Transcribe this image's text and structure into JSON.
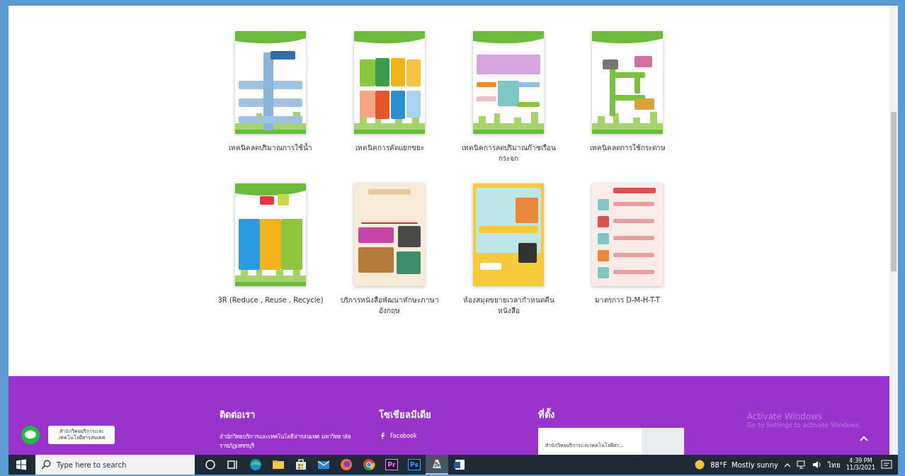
{
  "posters": [
    {
      "kind": "water",
      "caption": "เทคนิคลดปริมาณการใช้น้ำ"
    },
    {
      "kind": "waste",
      "caption": "เทคนิคการคัดแยกขยะ"
    },
    {
      "kind": "greenhouse",
      "caption": "เทคนิคการลดปริมาณก๊าซเรือนกระจก"
    },
    {
      "kind": "paper",
      "caption": "เทคนิคลดการใช้กระดาษ"
    },
    {
      "kind": "recycle",
      "caption": "3R (Reduce , Reuse , Recycle)"
    },
    {
      "kind": "english",
      "caption": "บริการหนังสือพัฒนาทักษะภาษาอังกฤษ"
    },
    {
      "kind": "library",
      "caption": "ห้องสมุดขยายเวลากำหนดคืนหนังสือ"
    },
    {
      "kind": "health",
      "caption": "มาตรการ D-M-H-T-T"
    }
  ],
  "footer": {
    "contact": {
      "heading": "ติดต่อเรา",
      "text": "สำนักวิทยบริการและเทคโนโลยีสารสนเทศ มหาวิทยาลัยราชภัฏเพชรบุรี"
    },
    "social": {
      "heading": "โซเชียลมีเดีย",
      "links": [
        "Facebook"
      ]
    },
    "location": {
      "heading": "ที่ตั้ง",
      "map_title": "สำนักวิทยบริการและเทคโนโลยีสา..."
    }
  },
  "chat_widget": {
    "bubble": "สำนักวิทยบริการและเทคโนโลยีสารสนเทศ"
  },
  "watermark": {
    "title": "Activate Windows",
    "subtitle": "Go to Settings to activate Windows."
  },
  "taskbar": {
    "search_placeholder": "Type here to search",
    "apps": [
      {
        "kind": "cortana",
        "selected": false
      },
      {
        "kind": "taskview",
        "selected": false
      },
      {
        "kind": "edge",
        "selected": false
      },
      {
        "kind": "explorer",
        "selected": false
      },
      {
        "kind": "store",
        "selected": false
      },
      {
        "kind": "mail",
        "selected": false
      },
      {
        "kind": "firefox",
        "selected": false
      },
      {
        "kind": "chrome",
        "selected": false
      },
      {
        "kind": "premiere",
        "label": "Pr",
        "selected": false
      },
      {
        "kind": "photoshop",
        "label": "Ps",
        "selected": false
      },
      {
        "kind": "paint",
        "selected": true
      },
      {
        "kind": "word",
        "selected": false
      }
    ],
    "weather": "88°F  Mostly sunny",
    "language": "ไทย",
    "time": "4:39 PM",
    "date": "11/3/2021"
  }
}
